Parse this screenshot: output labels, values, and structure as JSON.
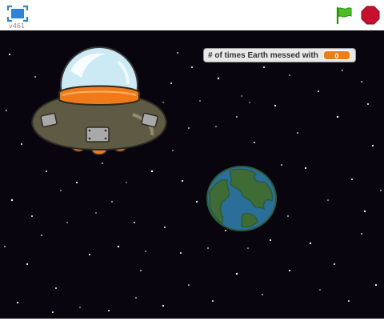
{
  "toolbar": {
    "version": "v461",
    "fullscreen_icon": "fullscreen-icon",
    "green_flag_icon": "green-flag-icon",
    "stop_icon": "stop-sign-icon"
  },
  "stage": {
    "monitor": {
      "label": "# of times Earth messed with",
      "value": "0"
    },
    "sprites": [
      "ufo",
      "earth"
    ]
  },
  "colors": {
    "stage_background": "#08050f",
    "monitor_value": "#ee7d16",
    "flag": "#4cbf22",
    "stop": "#c8102e",
    "accent": "#2b84d6"
  }
}
